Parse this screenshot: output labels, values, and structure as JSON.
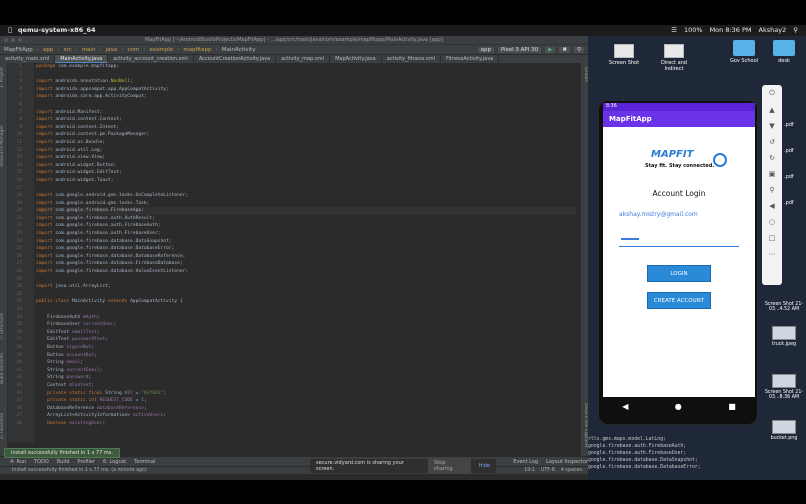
{
  "menubar": {
    "app": "qemu-system-x86_64",
    "battery": "100%",
    "clock": "Mon 8:36 PM",
    "user": "Akshay2"
  },
  "ide": {
    "window_title": "MapFitApp [~/AndroidStudioProjects/MapFitApp] - .../app/src/main/java/com/example/mapfitapp/MainActivity.java [app]",
    "breadcrumb": [
      "MapFitApp",
      "app",
      "src",
      "main",
      "java",
      "com",
      "example",
      "mapfitapp",
      "MainActivity"
    ],
    "run_config": "app",
    "device": "Pixel 3 API 30",
    "tabs": [
      {
        "label": "activity_main.xml",
        "active": false
      },
      {
        "label": "MainActivity.java",
        "active": true
      },
      {
        "label": "activity_account_creation.xml",
        "active": false
      },
      {
        "label": "AccountCreationActivity.java",
        "active": false
      },
      {
        "label": "activity_map.xml",
        "active": false
      },
      {
        "label": "MapActivity.java",
        "active": false
      },
      {
        "label": "activity_fitness.xml",
        "active": false
      },
      {
        "label": "FitnessActivity.java",
        "active": false
      }
    ],
    "left_tools": [
      "1: Project",
      "Resource Manager",
      "7: Structure",
      "Build Variants",
      "2: Favorites"
    ],
    "right_tools": [
      "Gradle",
      "Device File Explorer"
    ],
    "bottom_tools": [
      "4: Run",
      "TODO",
      "Build",
      "Profiler",
      "6: Logcat",
      "Terminal",
      "Event Log",
      "Layout Inspector"
    ],
    "status_text": "Install successfully finished in 1 s 77 ms. (a minute ago)",
    "status_right": [
      "19:1",
      "UTF-8",
      "4 spaces"
    ],
    "toast": "Install successfully finished in 1 s 77 ms.",
    "code_lines": [
      {
        "n": "1",
        "html": "<span class=\"kw\">package</span> com.example.mapfitapp;"
      },
      {
        "n": "2",
        "html": ""
      },
      {
        "n": "3",
        "html": "<span class=\"kw\">import</span> androidx.annotation.<span class=\"ann\">NonNull</span>;"
      },
      {
        "n": "4",
        "html": "<span class=\"kw\">import</span> androidx.appcompat.app.AppCompatActivity;"
      },
      {
        "n": "5",
        "html": "<span class=\"kw\">import</span> androidx.core.app.ActivityCompat;"
      },
      {
        "n": "6",
        "html": ""
      },
      {
        "n": "7",
        "html": "<span class=\"kw\">import</span> android.Manifest;"
      },
      {
        "n": "8",
        "html": "<span class=\"kw\">import</span> android.content.Context;"
      },
      {
        "n": "9",
        "html": "<span class=\"kw\">import</span> android.content.Intent;"
      },
      {
        "n": "10",
        "html": "<span class=\"kw\">import</span> android.content.pm.PackageManager;"
      },
      {
        "n": "11",
        "html": "<span class=\"kw\">import</span> android.os.Bundle;"
      },
      {
        "n": "12",
        "html": "<span class=\"kw\">import</span> android.util.Log;"
      },
      {
        "n": "13",
        "html": "<span class=\"kw\">import</span> android.view.View;"
      },
      {
        "n": "14",
        "html": "<span class=\"kw\">import</span> android.widget.Button;"
      },
      {
        "n": "15",
        "html": "<span class=\"kw\">import</span> android.widget.EditText;"
      },
      {
        "n": "16",
        "html": "<span class=\"kw\">import</span> android.widget.Toast;"
      },
      {
        "n": "17",
        "html": ""
      },
      {
        "n": "18",
        "html": "<span class=\"kw\">import</span> com.google.android.gms.tasks.OnCompleteListener;"
      },
      {
        "n": "19",
        "html": "<span class=\"kw\">import</span> com.google.android.gms.tasks.Task;"
      },
      {
        "n": "20",
        "html": "<span class=\"kw\">import</span> com.google.firebase.FirebaseApp;"
      },
      {
        "n": "21",
        "html": "<span class=\"kw\">import</span> com.google.firebase.auth.AuthResult;"
      },
      {
        "n": "22",
        "html": "<span class=\"kw\">import</span> com.google.firebase.auth.FirebaseAuth;"
      },
      {
        "n": "23",
        "html": "<span class=\"kw\">import</span> com.google.firebase.auth.FirebaseUser;"
      },
      {
        "n": "24",
        "html": "<span class=\"kw\">import</span> com.google.firebase.database.DataSnapshot;"
      },
      {
        "n": "25",
        "html": "<span class=\"kw\">import</span> com.google.firebase.database.DatabaseError;"
      },
      {
        "n": "26",
        "html": "<span class=\"kw\">import</span> com.google.firebase.database.DatabaseReference;"
      },
      {
        "n": "27",
        "html": "<span class=\"kw\">import</span> com.google.firebase.database.FirebaseDatabase;"
      },
      {
        "n": "28",
        "html": "<span class=\"kw\">import</span> com.google.firebase.database.ValueEventListener;"
      },
      {
        "n": "29",
        "html": ""
      },
      {
        "n": "30",
        "html": "<span class=\"kw\">import</span> java.util.ArrayList;"
      },
      {
        "n": "31",
        "html": ""
      },
      {
        "n": "32",
        "html": "<span class=\"kw\">public class</span> MainActivity <span class=\"kw\">extends</span> AppCompatActivity {"
      },
      {
        "n": "33",
        "html": ""
      },
      {
        "n": "34",
        "html": "    FirebaseAuth <span class=\"fld\">mAuth</span>;"
      },
      {
        "n": "35",
        "html": "    FirebaseUser <span class=\"fld\">currentUser</span>;"
      },
      {
        "n": "36",
        "html": "    EditText <span class=\"fld\">emailText</span>;"
      },
      {
        "n": "37",
        "html": "    EditText <span class=\"fld\">passwordText</span>;"
      },
      {
        "n": "38",
        "html": "    Button <span class=\"fld\">signinBut</span>;"
      },
      {
        "n": "39",
        "html": "    Button <span class=\"fld\">accountBut</span>;"
      },
      {
        "n": "40",
        "html": "    String <span class=\"fld\">email</span>;"
      },
      {
        "n": "41",
        "html": "    String <span class=\"fld\">currentEmail</span>;"
      },
      {
        "n": "42",
        "html": "    String <span class=\"fld\">password</span>;"
      },
      {
        "n": "43",
        "html": "    Context <span class=\"fld\">mContext</span>;"
      },
      {
        "n": "44",
        "html": "    <span class=\"kw\">private static final</span> String <span class=\"fld\">KEY</span> = <span class=\"str\">\"KEY001\"</span>;"
      },
      {
        "n": "45",
        "html": "    <span class=\"kw\">private static int</span> <span class=\"fld\">REQUEST_CODE</span> = <span class=\"num\">1</span>;"
      },
      {
        "n": "46",
        "html": "    DatabaseReference <span class=\"fld\">databaseReference</span>;"
      },
      {
        "n": "47",
        "html": "    ArrayList&lt;ActivityInformation&gt; <span class=\"fld\">activeUsers</span>;"
      },
      {
        "n": "48",
        "html": "    <span class=\"kw\">boolean</span> <span class=\"fld\">existingUser</span>;"
      }
    ]
  },
  "share": {
    "text": "secure.vidyard.com is sharing your screen.",
    "stop": "Stop sharing",
    "hide": "Hide"
  },
  "desktop": {
    "icons": [
      "Screen Shot",
      "Direct and Indirect",
      "Gov School",
      "desk"
    ],
    "side_files": [
      ".pdf",
      ".pdf",
      ".pdf",
      ".pdf"
    ],
    "shots": [
      {
        "label": "Screen Shot 21-03...4.52 AM"
      },
      {
        "label": "truck.jpeg"
      },
      {
        "label": "Screen Shot 21-03...8.36 AM"
      },
      {
        "label": "bucket.png"
      }
    ]
  },
  "emulator": {
    "status_time": "8:36",
    "app_name": "MapFitApp",
    "logo_text": "MAPFIT",
    "tagline": "Stay fit. Stay connected.",
    "title": "Account Login",
    "email_value": "akshay.mistry@gmail.com",
    "login_label": "LOGIN",
    "create_label": "CREATE ACCOUNT"
  },
  "code_overlay": "rtls.gms.maps.model.LatLng;\ngoogle.firebase.auth.FirebaseAuth;\ngoogle.firebase.auth.FirebaseUser;\ngoogle.firebase.database.DataSnapshot;\ngoogle.firebase.database.DatabaseError;"
}
